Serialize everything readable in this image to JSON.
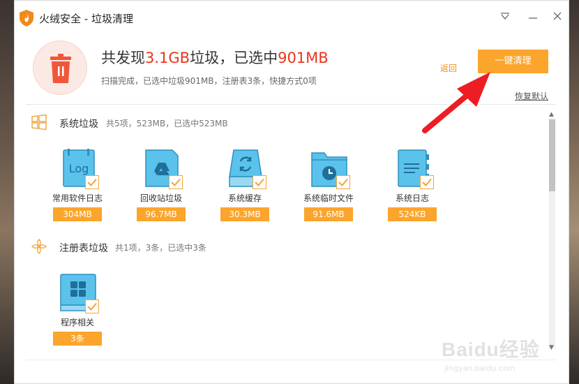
{
  "window": {
    "title": "火绒安全 - 垃圾清理"
  },
  "header": {
    "headline_prefix": "共发现",
    "headline_found": "3.1GB",
    "headline_middle": "垃圾，已选中",
    "headline_selected": "901MB",
    "subline": "扫描完成，已选中垃圾901MB，注册表3条，快捷方式0项",
    "back_label": "返回",
    "clean_label": "一键清理",
    "restore_label": "恢复默认"
  },
  "sections": [
    {
      "title": "系统垃圾",
      "summary": "共5项，523MB，已选中523MB",
      "icon": "windows-icon",
      "items": [
        {
          "label": "常用软件日志",
          "size": "304MB",
          "icon": "log-file-icon",
          "checked": true
        },
        {
          "label": "回收站垃圾",
          "size": "96.7MB",
          "icon": "recycle-bin-icon",
          "checked": true
        },
        {
          "label": "系统缓存",
          "size": "30.3MB",
          "icon": "cache-drive-icon",
          "checked": true
        },
        {
          "label": "系统临时文件",
          "size": "91.6MB",
          "icon": "temp-folder-icon",
          "checked": true
        },
        {
          "label": "系统日志",
          "size": "524KB",
          "icon": "document-icon",
          "checked": true
        }
      ]
    },
    {
      "title": "注册表垃圾",
      "summary": "共1项，3条，已选中3条",
      "icon": "registry-icon",
      "items": [
        {
          "label": "程序相关",
          "size": "3条",
          "icon": "program-grid-icon",
          "checked": true
        }
      ]
    }
  ],
  "watermark": {
    "main": "Baidu经验",
    "sub": "jingyan.baidu.com"
  },
  "colors": {
    "accent_orange": "#fba52c",
    "highlight_red": "#e8361b",
    "tile_blue": "#5bc2ec",
    "trash_red": "#f0563a",
    "arrow_red": "#ee1c25"
  }
}
